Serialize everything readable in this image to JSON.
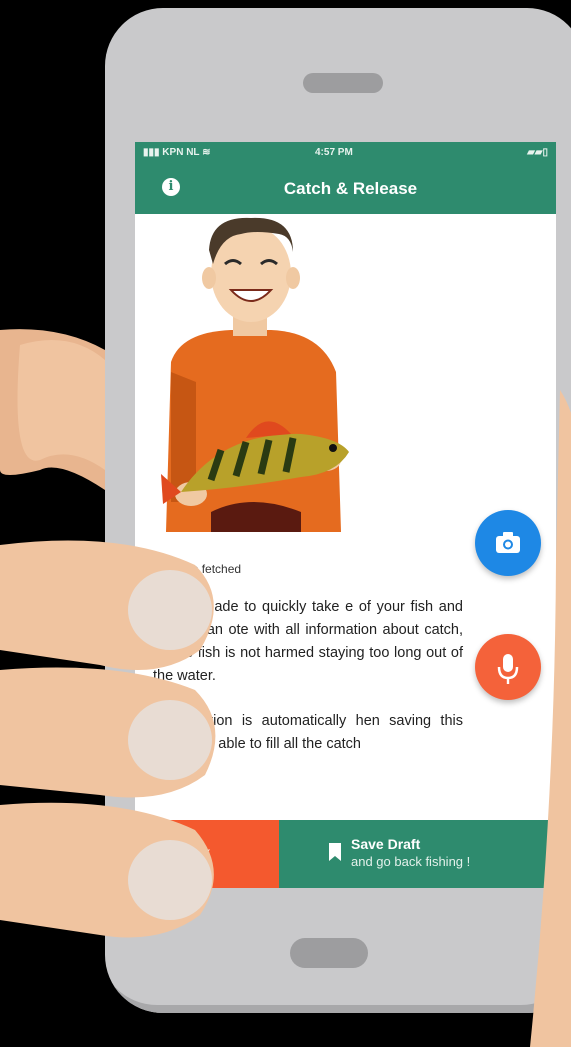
{
  "status_bar": {
    "carrier": "KPN NL",
    "time": "4:57 PM"
  },
  "app_bar": {
    "title": "Catch & Release"
  },
  "main": {
    "location_status": "location fetched",
    "description_paragraphs": [
      "atch is made to quickly take e of your fish and register an ote with all information about catch, so the fish is not harmed staying too long out of the water.",
      "ed, location is automatically hen saving this draft. You able to fill all the catch"
    ]
  },
  "bottom_bar": {
    "back_label": "Back",
    "save_label": "Save Draft",
    "save_sublabel": "and go back fishing !"
  },
  "colors": {
    "brand_green": "#2e8b6e",
    "camera_blue": "#1e88e5",
    "mic_orange": "#f4623a",
    "back_orange": "#f4592e"
  },
  "icons": [
    "info-icon",
    "camera-icon",
    "microphone-icon",
    "bookmark-icon",
    "wifi-icon",
    "signal-icon",
    "battery-icon"
  ]
}
